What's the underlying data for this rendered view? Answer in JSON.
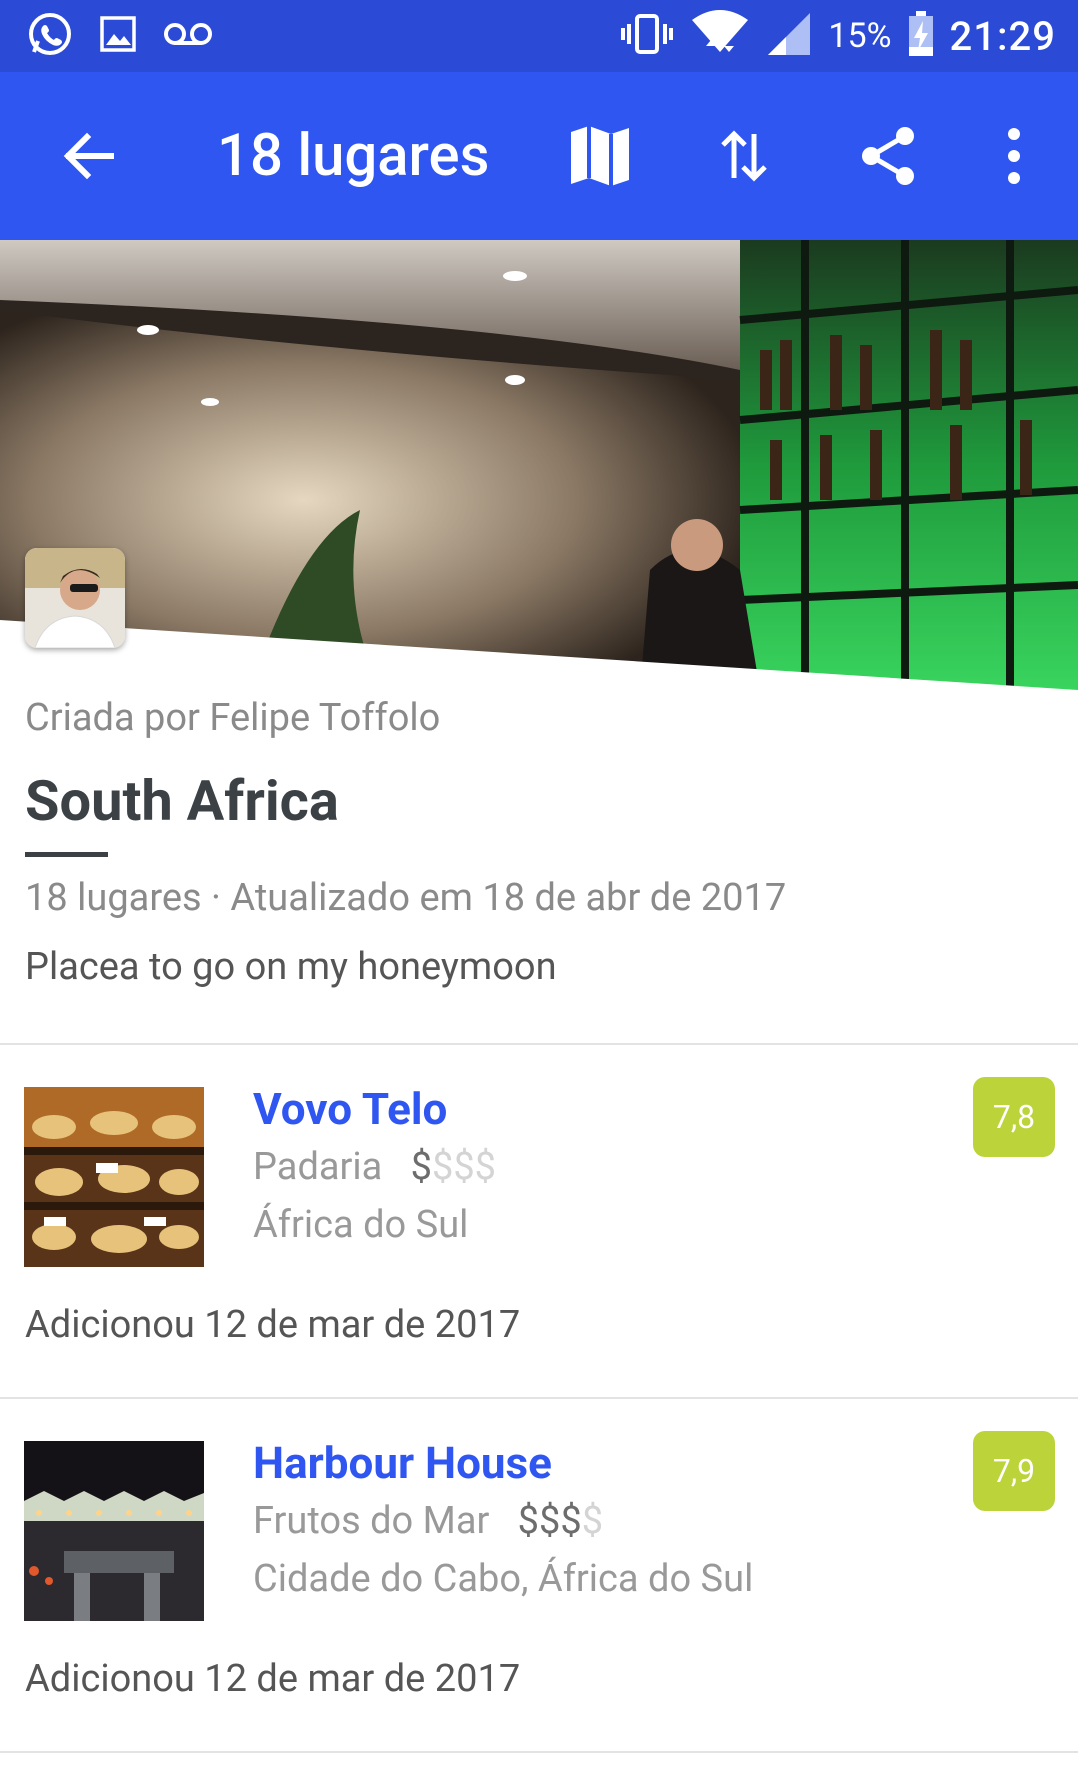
{
  "status_bar": {
    "battery": "15%",
    "time": "21:29",
    "icons": [
      "whatsapp-icon",
      "gallery-icon",
      "voicemail-icon",
      "vibrate-icon",
      "wifi-icon",
      "signal-icon",
      "battery-charging-icon"
    ]
  },
  "app_bar": {
    "title": "18 lugares",
    "actions": [
      "back-arrow-icon",
      "map-icon",
      "sort-icon",
      "share-icon",
      "more-vert-icon"
    ]
  },
  "list_info": {
    "created_by": "Criada por Felipe Toffolo",
    "title": "South Africa",
    "updated": "18 lugares · Atualizado em 18 de abr de 2017",
    "description": "Placea to go on my honeymoon"
  },
  "places": [
    {
      "name": "Vovo Telo",
      "category": "Padaria",
      "price_active": "$",
      "price_inactive": "$$$",
      "location": "África do Sul",
      "added": "Adicionou 12 de mar de 2017",
      "score": "7,8"
    },
    {
      "name": "Harbour House",
      "category": "Frutos do Mar",
      "price_active": "$$$",
      "price_inactive": "$",
      "location": "Cidade do Cabo, África do Sul",
      "added": "Adicionou 12 de mar de 2017",
      "score": "7,9"
    }
  ],
  "colors": {
    "status_bar": "#2b4bd6",
    "app_bar": "#2f56f0",
    "place_name": "#2f56f0",
    "score_badge": "#bcd43a",
    "title_text": "#3b4145"
  }
}
